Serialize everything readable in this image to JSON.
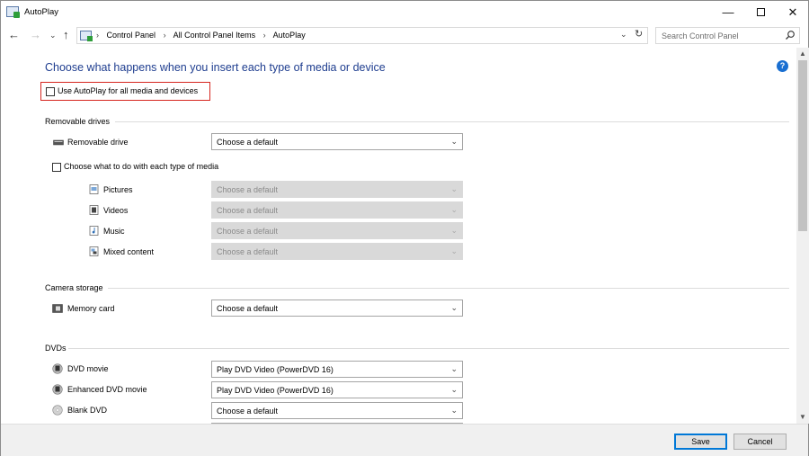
{
  "window": {
    "title": "AutoPlay",
    "controls": {
      "minimize": "—",
      "close": "✕"
    }
  },
  "nav": {
    "back": "←",
    "forward": "→",
    "recent": "⌄",
    "up": "↑",
    "breadcrumbs": [
      "Control Panel",
      "All Control Panel Items",
      "AutoPlay"
    ],
    "separator": "›",
    "dropdown": "⌄",
    "refresh": "↻",
    "search_placeholder": "Search Control Panel"
  },
  "page": {
    "title": "Choose what happens when you insert each type of media or device",
    "help": "?",
    "use_autoplay_label": "Use AutoPlay for all media and devices"
  },
  "sections": {
    "removable": {
      "header": "Removable drives",
      "drive_label": "Removable drive",
      "drive_value": "Choose a default",
      "each_type_label": "Choose what to do with each type of media",
      "media": [
        {
          "label": "Pictures",
          "value": "Choose a default",
          "icon": "pictures-icon"
        },
        {
          "label": "Videos",
          "value": "Choose a default",
          "icon": "videos-icon"
        },
        {
          "label": "Music",
          "value": "Choose a default",
          "icon": "music-icon"
        },
        {
          "label": "Mixed content",
          "value": "Choose a default",
          "icon": "mixed-content-icon"
        }
      ]
    },
    "camera": {
      "header": "Camera storage",
      "memory_label": "Memory card",
      "memory_value": "Choose a default"
    },
    "dvds": {
      "header": "DVDs",
      "items": [
        {
          "label": "DVD movie",
          "value": "Play DVD Video (PowerDVD 16)"
        },
        {
          "label": "Enhanced DVD movie",
          "value": "Play DVD Video (PowerDVD 16)"
        },
        {
          "label": "Blank DVD",
          "value": "Choose a default"
        }
      ]
    }
  },
  "footer": {
    "save": "Save",
    "cancel": "Cancel"
  },
  "colors": {
    "title_blue": "#1e3d8f",
    "highlight_red": "#d6261f",
    "accent": "#0078d7"
  }
}
